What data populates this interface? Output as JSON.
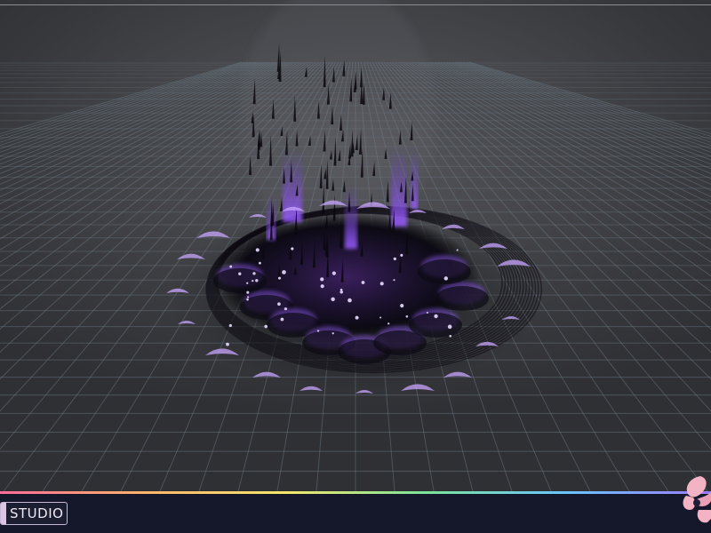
{
  "viewport": {
    "description_icon": "vfx-preview-scene",
    "effect_icon": "dark-purple-ground-vortex-icon",
    "colors": {
      "background": "#46474b",
      "grid_line": "#6e7f8a",
      "effect_dark": "#0d0a12",
      "effect_purple": "#8a55e8",
      "effect_glow": "#c9a6ff"
    }
  },
  "bottom_bar": {
    "brand_label": "STUDIO",
    "corner_logo_icon": "studio-flower-logo-icon",
    "colors": {
      "bar": "#15182a",
      "logo_pink": "#f3b3c4",
      "logo_dark": "#1c2036"
    }
  }
}
